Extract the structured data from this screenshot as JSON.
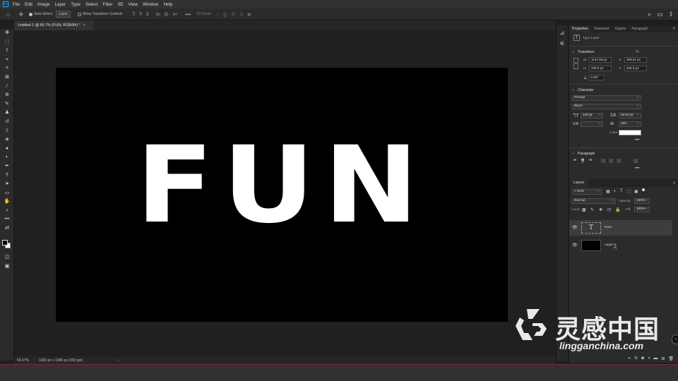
{
  "menu": {
    "logo_text": "Ps",
    "items": [
      "File",
      "Edit",
      "Image",
      "Layer",
      "Type",
      "Select",
      "Filter",
      "3D",
      "View",
      "Window",
      "Help"
    ]
  },
  "options": {
    "auto_select_label": "Auto-Select:",
    "layer_select": "Layer",
    "show_transform_label": "Show Transform Controls",
    "mode_3d_label": "3D Mode:"
  },
  "document": {
    "tab_title": "Untitled-1 @ 66.7% (FUN, RGB/8#) *",
    "text": "FUN",
    "background_color": "#000000",
    "text_color": "#ffffff"
  },
  "status": {
    "zoom": "66.67%",
    "doc_info": "1920 px x 1080 px (300 ppi)"
  },
  "properties": {
    "tabs": [
      "Properties",
      "Character",
      "Glyphs",
      "Paragraph"
    ],
    "layer_kind": "Type Layer",
    "transform_title": "Transform",
    "w_label": "W",
    "w": "1147.99 px",
    "x_label": "X",
    "x": "399.51 px",
    "h_label": "H",
    "h": "439.5 px",
    "y_label": "Y",
    "y": "265.5 px",
    "angle": "0.00°",
    "character_title": "Character",
    "font_family": "Prompt",
    "font_style": "Black",
    "font_size": "120 pt",
    "leading": "62.04 pt",
    "tracking": "100",
    "color_label": "Color",
    "text_color": "#ffffff",
    "paragraph_title": "Paragraph"
  },
  "layers": {
    "tab": "Layers",
    "filter_kind": "Kind",
    "blend_mode": "Normal",
    "opacity_label": "Opacity:",
    "opacity": "100%",
    "lock_label": "Lock:",
    "fill_label": "Fill:",
    "fill": "100%",
    "items": [
      {
        "name": "FUN",
        "type": "text",
        "selected": true
      },
      {
        "name": "Layer 0",
        "type": "fill",
        "selected": false
      }
    ]
  },
  "watermark": {
    "title": "灵感中国",
    "subtitle": "lingganchina.com"
  }
}
